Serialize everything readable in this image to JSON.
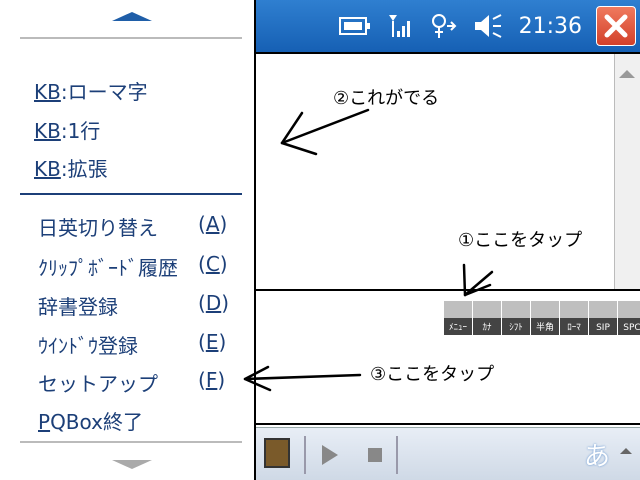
{
  "status_bar": {
    "clock": "21:36",
    "icons": [
      "battery-icon",
      "signal-icon",
      "sync-icon",
      "volume-icon"
    ]
  },
  "menu": {
    "section1": [
      {
        "prefix": "KB",
        "rest": ":ローマ字"
      },
      {
        "prefix": "KB",
        "rest": ":1行"
      },
      {
        "prefix": "KB",
        "rest": ":拡張"
      }
    ],
    "section2": [
      {
        "label": "日英切り替え",
        "key": "A"
      },
      {
        "label": "ｸﾘｯﾌﾟﾎﾞｰﾄﾞ履歴",
        "key": "C"
      },
      {
        "label": "辞書登録",
        "key": "D"
      },
      {
        "label": "ｳｲﾝﾄﾞｳ登録",
        "key": "E"
      },
      {
        "label": "セットアップ",
        "key": "F"
      },
      {
        "label_u": "P",
        "label_rest": "QBox終了"
      }
    ]
  },
  "keyboard_bar": [
    "ﾒﾆｭｰ",
    "ｶﾅ",
    "ｼﾌﾄ",
    "半角",
    "ﾛｰﾏ",
    "SIP",
    "SPC"
  ],
  "taskbar": {
    "ime": "あ"
  },
  "annotations": {
    "note2": "②これがでる",
    "note1": "①ここをタップ",
    "note3": "③ここをタップ"
  },
  "colors": {
    "title_bar": "#1f6fc4",
    "menu_text": "#1c3f78",
    "close": "#d9482f"
  }
}
